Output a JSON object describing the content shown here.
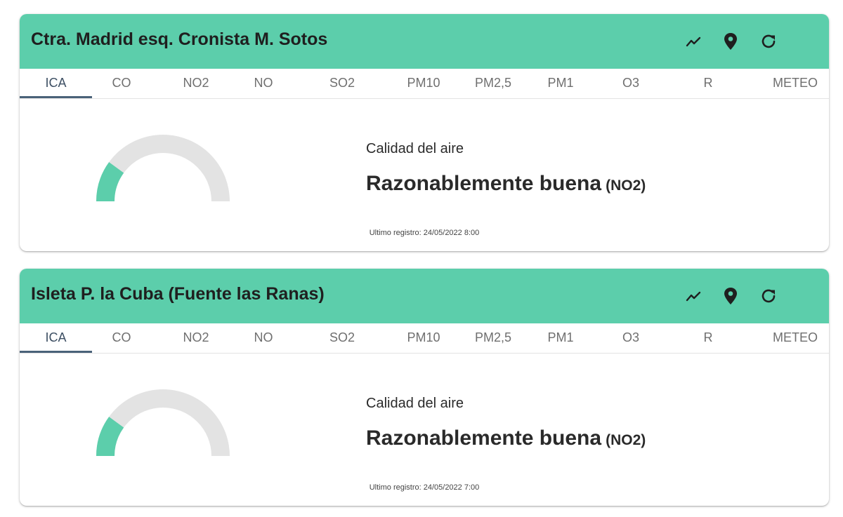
{
  "theme": {
    "header_color": "#5cceab",
    "gauge_fill_color": "#5cceab",
    "gauge_track_color": "#e3e3e3",
    "active_tab_color": "#4a6279"
  },
  "header_icons": [
    "chart-line-icon",
    "map-marker-icon",
    "refresh-icon"
  ],
  "stations": [
    {
      "title": "Ctra. Madrid esq. Cronista M. Sotos",
      "tabs": [
        "ICA",
        "CO",
        "NO2",
        "NO",
        "SO2",
        "PM10",
        "PM2,5",
        "PM1",
        "O3",
        "R",
        "METEO"
      ],
      "active_tab": "ICA",
      "gauge_level": 0.2,
      "quality_label": "Calidad del aire",
      "quality_value": "Razonablemente buena",
      "pollutant": "(NO2)",
      "last_record": "Ultimo registro: 24/05/2022 8:00"
    },
    {
      "title": "Isleta P. la Cuba (Fuente las Ranas)",
      "tabs": [
        "ICA",
        "CO",
        "NO2",
        "NO",
        "SO2",
        "PM10",
        "PM2,5",
        "PM1",
        "O3",
        "R",
        "METEO"
      ],
      "active_tab": "ICA",
      "gauge_level": 0.2,
      "quality_label": "Calidad del aire",
      "quality_value": "Razonablemente buena",
      "pollutant": "(NO2)",
      "last_record": "Ultimo registro: 24/05/2022 7:00"
    }
  ]
}
